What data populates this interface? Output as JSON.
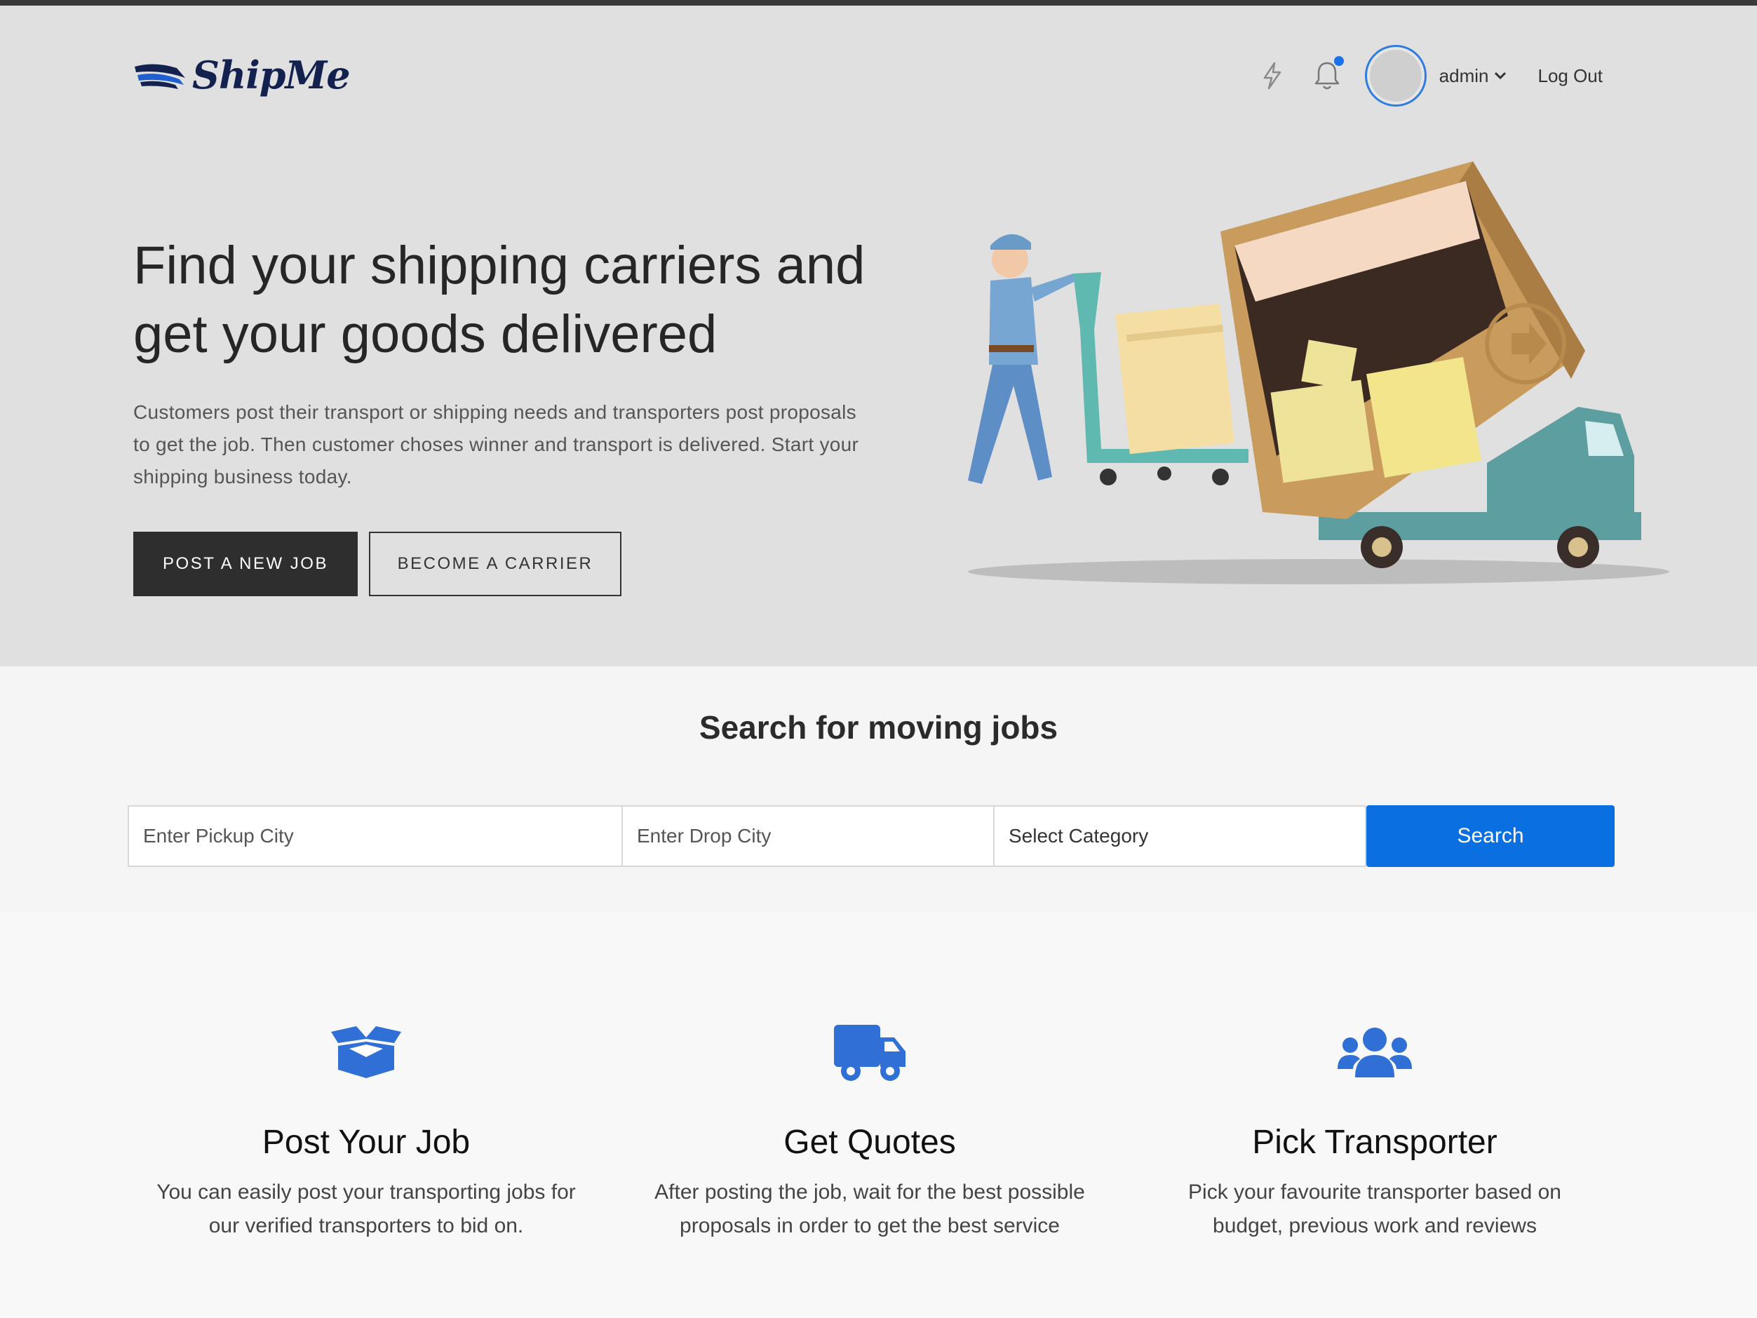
{
  "brand": {
    "name": "ShipMe"
  },
  "nav": {
    "icons": [
      "bolt-icon",
      "bell-icon"
    ],
    "username": "admin",
    "logout_label": "Log Out"
  },
  "hero": {
    "title_line1": "Find your shipping carriers and",
    "title_line2": "get your goods delivered",
    "description": "Customers post their transport or shipping needs and transporters post proposals to get the job. Then customer choses winner and transport is delivered. Start your shipping business today.",
    "primary_button": "POST A NEW JOB",
    "secondary_button": "BECOME A CARRIER"
  },
  "search": {
    "title": "Search for moving jobs",
    "pickup_placeholder": "Enter Pickup City",
    "drop_placeholder": "Enter Drop City",
    "category_label": "Select Category",
    "button_label": "Search"
  },
  "features": [
    {
      "icon": "open-box-icon",
      "title": "Post Your Job",
      "text_line1": "You can easily post your transporting jobs for",
      "text_line2": "our verified transporters to bid on."
    },
    {
      "icon": "truck-icon",
      "title": "Get Quotes",
      "text_line1": "After posting the job, wait for the best possible",
      "text_line2": "proposals in order to get the best service"
    },
    {
      "icon": "users-icon",
      "title": "Pick Transporter",
      "text_line1": "Pick your favourite transporter based on",
      "text_line2": "budget, previous work and reviews"
    }
  ],
  "colors": {
    "accent": "#0a6fe0",
    "icon_blue": "#2f6fd6",
    "dark_button": "#2e2e2e",
    "logo_navy": "#13214f",
    "hero_bg": "#e0e0e0"
  }
}
